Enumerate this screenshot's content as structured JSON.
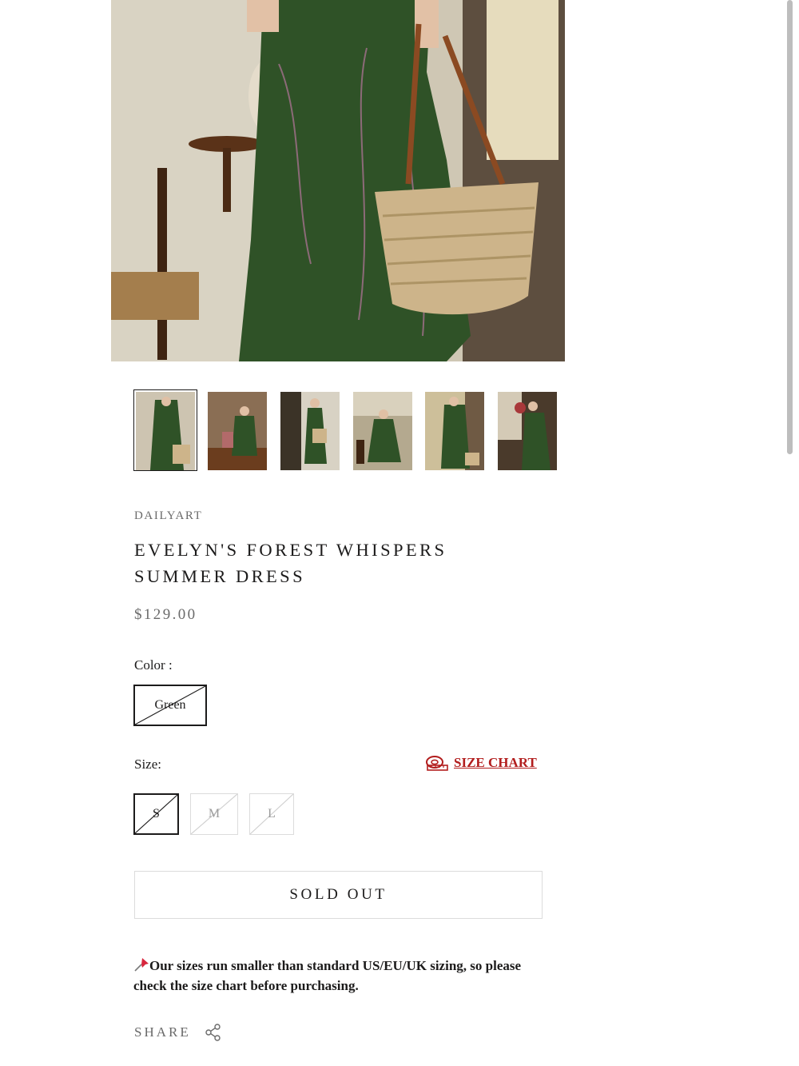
{
  "product": {
    "vendor": "DAILYART",
    "title": "EVELYN'S FOREST WHISPERS SUMMER DRESS",
    "price": "$129.00",
    "color_label": "Color :",
    "size_label": "Size:",
    "size_chart_label": "SIZE CHART",
    "sold_out_label": "SOLD OUT",
    "notice": "Our sizes run smaller than standard US/EU/UK sizing, so please check the size chart before purchasing.",
    "share_label": "SHARE"
  },
  "options": {
    "colors": [
      {
        "label": "Green",
        "selected": true,
        "unavailable": true
      }
    ],
    "sizes": [
      {
        "label": "S",
        "selected": true,
        "unavailable": true
      },
      {
        "label": "M",
        "selected": false,
        "unavailable": true
      },
      {
        "label": "L",
        "selected": false,
        "unavailable": true
      }
    ]
  },
  "gallery": {
    "thumbnail_count": 6,
    "active_index": 0
  },
  "colors": {
    "accent_red": "#b21d1d",
    "text": "#1c1b1b",
    "muted": "#6a6a6a",
    "border": "#dcdcdc",
    "dress_green": "#2f5227"
  }
}
